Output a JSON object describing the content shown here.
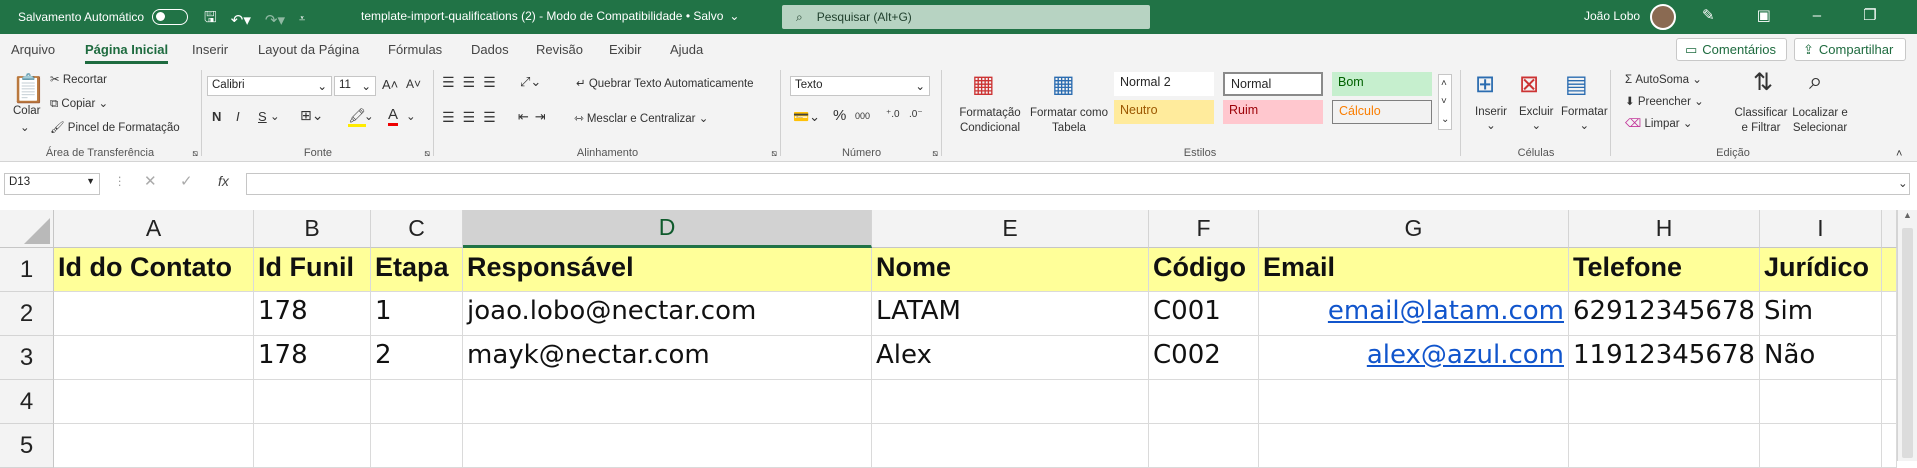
{
  "titlebar": {
    "autosave_label": "Salvamento Automático",
    "file_title": "template-import-qualifications (2)  -  Modo de Compatibilidade • Salvo",
    "search_placeholder": "Pesquisar (Alt+G)",
    "user_name": "João Lobo"
  },
  "tabs": [
    "Arquivo",
    "Página Inicial",
    "Inserir",
    "Layout da Página",
    "Fórmulas",
    "Dados",
    "Revisão",
    "Exibir",
    "Ajuda"
  ],
  "active_tab": "Página Inicial",
  "comments_label": "Comentários",
  "share_label": "Compartilhar",
  "ribbon": {
    "clipboard": {
      "paste": "Colar",
      "cut": "Recortar",
      "copy": "Copiar",
      "format_painter": "Pincel de Formatação",
      "label": "Área de Transferência"
    },
    "font": {
      "name": "Calibri",
      "size": "11",
      "bold": "N",
      "italic": "I",
      "underline": "S",
      "label": "Fonte"
    },
    "alignment": {
      "wrap": "Quebrar Texto Automaticamente",
      "merge": "Mesclar e Centralizar",
      "label": "Alinhamento"
    },
    "number": {
      "format": "Texto",
      "label": "Número"
    },
    "styles": {
      "cond_format": "Formatação Condicional",
      "format_table": "Formatar como Tabela",
      "cells": [
        "Normal 2",
        "Normal",
        "Bom",
        "Neutro",
        "Ruim",
        "Cálculo"
      ],
      "label": "Estilos"
    },
    "cells": {
      "insert": "Inserir",
      "delete": "Excluir",
      "format": "Formatar",
      "label": "Células"
    },
    "editing": {
      "autosum": "AutoSoma",
      "fill": "Preencher",
      "clear": "Limpar",
      "sort": "Classificar e Filtrar",
      "find": "Localizar e Selecionar",
      "label": "Edição"
    }
  },
  "formula_bar": {
    "name_box": "D13",
    "fx": "fx",
    "value": ""
  },
  "columns": [
    "A",
    "B",
    "C",
    "D",
    "E",
    "F",
    "G",
    "H",
    "I"
  ],
  "rows": [
    "1",
    "2",
    "3",
    "4",
    "5"
  ],
  "cells": [
    [
      "Id do Contato",
      "Id Funil",
      "Etapa",
      "Responsável",
      "Nome",
      "Código",
      "Email",
      "Telefone",
      "Jurídico"
    ],
    [
      "",
      "178",
      "1",
      "joao.lobo@nectar.com",
      "LATAM",
      "C001",
      "email@latam.com",
      "62912345678",
      "Sim"
    ],
    [
      "",
      "178",
      "2",
      "mayk@nectar.com",
      "Alex",
      "C002",
      "alex@azul.com",
      "11912345678",
      "Não"
    ],
    [
      "",
      "",
      "",
      "",
      "",
      "",
      "",
      "",
      ""
    ],
    [
      "",
      "",
      "",
      "",
      "",
      "",
      "",
      "",
      ""
    ]
  ],
  "colors": {
    "excel_green": "#217346",
    "header_fill": "#ffff99",
    "link": "#1155cc"
  }
}
